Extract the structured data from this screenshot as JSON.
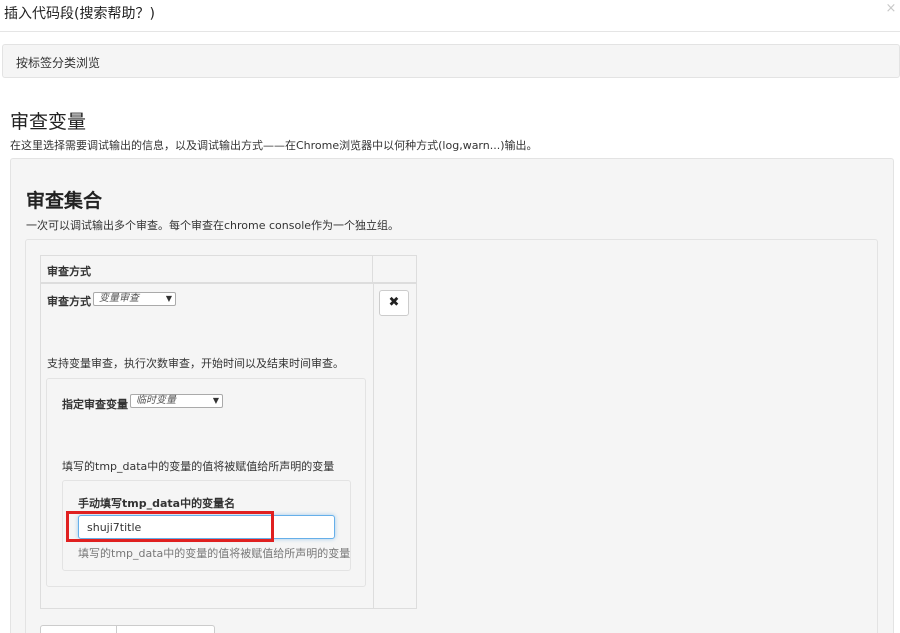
{
  "modal": {
    "title": "插入代码段(搜索帮助？)",
    "close_symbol": "×"
  },
  "tag_bar": {
    "label": "按标签分类浏览"
  },
  "section": {
    "title": "审查变量",
    "description": "在这里选择需要调试输出的信息，以及调试输出方式——在Chrome浏览器中以何种方式(log,warn...)输出。"
  },
  "inspection_set": {
    "title": "审查集合",
    "description": "一次可以调试输出多个审查。每个审查在chrome console作为一个独立组。"
  },
  "table": {
    "header": "审查方式"
  },
  "mode": {
    "label": "审查方式",
    "selected": "变量审查",
    "help": "支持变量审查，执行次数审查，开始时间以及结束时间审查。"
  },
  "delete_symbol": "✖",
  "variable": {
    "label": "指定审查变量",
    "selected": "临时变量",
    "help": "填写的tmp_data中的变量的值将被赋值给所声明的变量"
  },
  "name_field": {
    "label": "手动填写tmp_data中的变量名",
    "value": "shuji7title",
    "help": "填写的tmp_data中的变量的值将被赋值给所声明的变量"
  },
  "select_arrow": "▼",
  "colors": {
    "highlight": "#e02020",
    "focus_border": "#66afe9",
    "panel_bg": "#f5f5f5"
  }
}
